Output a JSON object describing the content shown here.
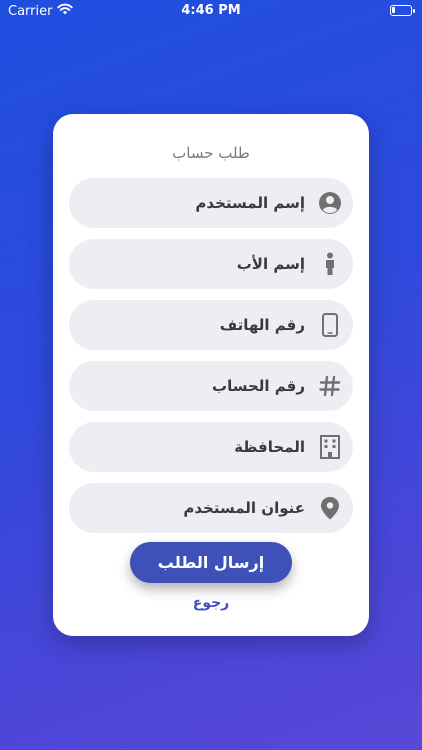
{
  "status_bar": {
    "carrier": "Carrier",
    "time": "4:46 PM"
  },
  "form": {
    "title": "طلب حساب",
    "fields": [
      {
        "label": "إسم المستخدم",
        "icon": "user-circle-icon"
      },
      {
        "label": "إسم الأب",
        "icon": "person-icon"
      },
      {
        "label": "رقم الهاتف",
        "icon": "phone-icon"
      },
      {
        "label": "رقم الحساب",
        "icon": "hash-icon"
      },
      {
        "label": "المحافظة",
        "icon": "building-icon"
      },
      {
        "label": "عنوان المستخدم",
        "icon": "location-pin-icon"
      }
    ],
    "submit_label": "إرسال الطلب",
    "back_label": "رجوع"
  },
  "colors": {
    "primary": "#3d51b9",
    "field_bg": "#efedf3",
    "icon": "#707070"
  }
}
